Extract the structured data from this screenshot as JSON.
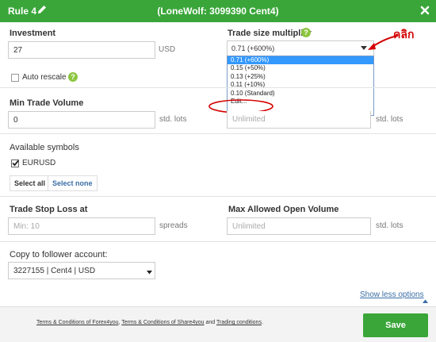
{
  "header": {
    "rule_label": "Rule 4",
    "title": "(LoneWolf: 3099390 Cent4)"
  },
  "investment": {
    "label": "Investment",
    "value": "27",
    "unit": "USD"
  },
  "multiplier": {
    "label": "Trade size multiplier",
    "selected": "0.71 (+600%)",
    "options": [
      "0.71 (+600%)",
      "0.15 (+50%)",
      "0.13 (+25%)",
      "0.11 (+10%)",
      "0.10 (Standard)",
      "Edit..."
    ]
  },
  "annotation": {
    "text": "คลิก"
  },
  "auto_rescale": {
    "label": "Auto rescale"
  },
  "min_volume": {
    "label": "Min Trade Volume",
    "value": "0",
    "unit": "std. lots"
  },
  "max_volume": {
    "placeholder": "Unlimited",
    "unit": "std. lots"
  },
  "symbols": {
    "label": "Available symbols",
    "items": [
      "EURUSD"
    ],
    "select_all": "Select all",
    "select_none": "Select none"
  },
  "stop_loss": {
    "label": "Trade Stop Loss at",
    "placeholder": "Min: 10",
    "unit": "spreads"
  },
  "max_open": {
    "label": "Max Allowed Open Volume",
    "placeholder": "Unlimited",
    "unit": "std. lots"
  },
  "copy_to": {
    "label": "Copy to follower account:",
    "value": "3227155 | Cent4 | USD"
  },
  "show_less": "Show less options",
  "footer": {
    "terms1": "Terms & Conditions of Forex4you",
    "sep1": ", ",
    "terms2": "Terms & Conditions of Share4you",
    "and": " and ",
    "trading": "Trading conditions",
    "end": "."
  },
  "save_label": "Save",
  "colors": {
    "header": "#3aa63a",
    "accent_link": "#3a6ea5",
    "annotation": "#d40000",
    "dropdown_selected": "#3399ff"
  }
}
